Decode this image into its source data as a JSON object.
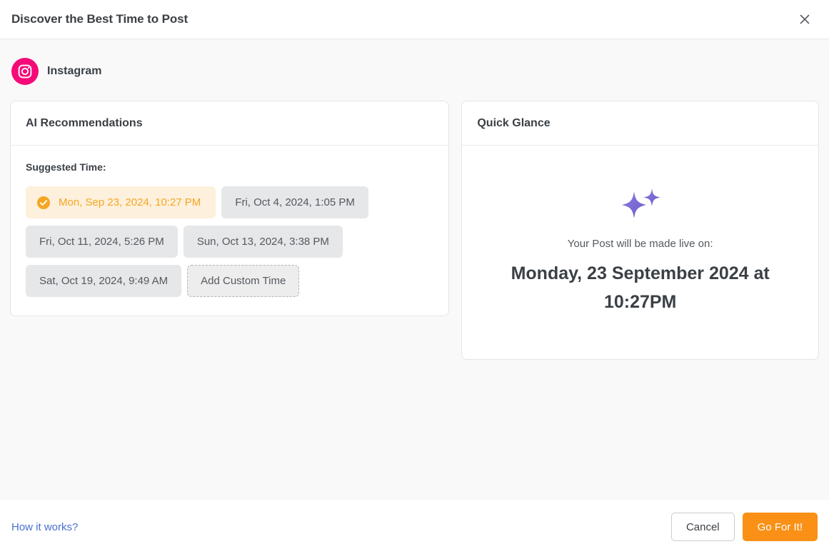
{
  "header": {
    "title": "Discover the Best Time to Post",
    "close_icon": "close-icon"
  },
  "platform": {
    "name": "Instagram",
    "icon": "instagram-icon",
    "color": "#f50a78"
  },
  "ai_recommendations": {
    "card_title": "AI Recommendations",
    "suggested_label": "Suggested Time:",
    "times": [
      {
        "label": "Mon, Sep 23, 2024, 10:27 PM",
        "selected": true
      },
      {
        "label": "Fri, Oct 4, 2024, 1:05 PM",
        "selected": false
      },
      {
        "label": "Fri, Oct 11, 2024, 5:26 PM",
        "selected": false
      },
      {
        "label": "Sun, Oct 13, 2024, 3:38 PM",
        "selected": false
      },
      {
        "label": "Sat, Oct 19, 2024, 9:49 AM",
        "selected": false
      }
    ],
    "add_custom_label": "Add Custom Time",
    "selected_color": "#f5a623",
    "selected_bg": "#fdf0dc"
  },
  "quick_glance": {
    "card_title": "Quick Glance",
    "sparkle_icon": "sparkles-icon",
    "sparkle_color": "#7b6bd6",
    "caption": "Your Post will be made live on:",
    "datetime": "Monday, 23 September 2024 at 10:27PM"
  },
  "footer": {
    "how_it_works": "How it works?",
    "how_it_works_color": "#4a6fd4",
    "cancel_label": "Cancel",
    "go_label": "Go For It!",
    "go_color": "#fa9016"
  }
}
